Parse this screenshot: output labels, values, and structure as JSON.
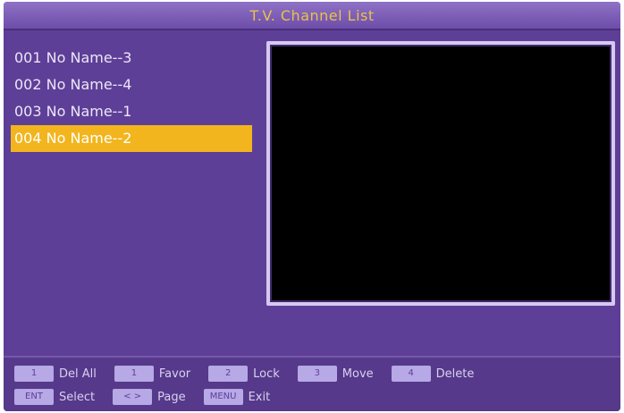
{
  "title": "T.V. Channel List",
  "channels": [
    {
      "label": "001 No Name--3"
    },
    {
      "label": "002 No Name--4"
    },
    {
      "label": "003 No Name--1"
    },
    {
      "label": "004 No Name--2"
    }
  ],
  "footer": {
    "row1": [
      {
        "key": "1",
        "label": "Del All"
      },
      {
        "key": "1",
        "label": "Favor"
      },
      {
        "key": "2",
        "label": "Lock"
      },
      {
        "key": "3",
        "label": "Move"
      },
      {
        "key": "4",
        "label": "Delete"
      }
    ],
    "row2": [
      {
        "key": "ENT",
        "label": "Select"
      },
      {
        "key": "< >",
        "label": "Page"
      },
      {
        "key": "MENU",
        "label": "Exit"
      }
    ]
  },
  "colors": {
    "background": "#5e3f97",
    "highlight": "#f2b51e",
    "title_text": "#e8c24a"
  }
}
